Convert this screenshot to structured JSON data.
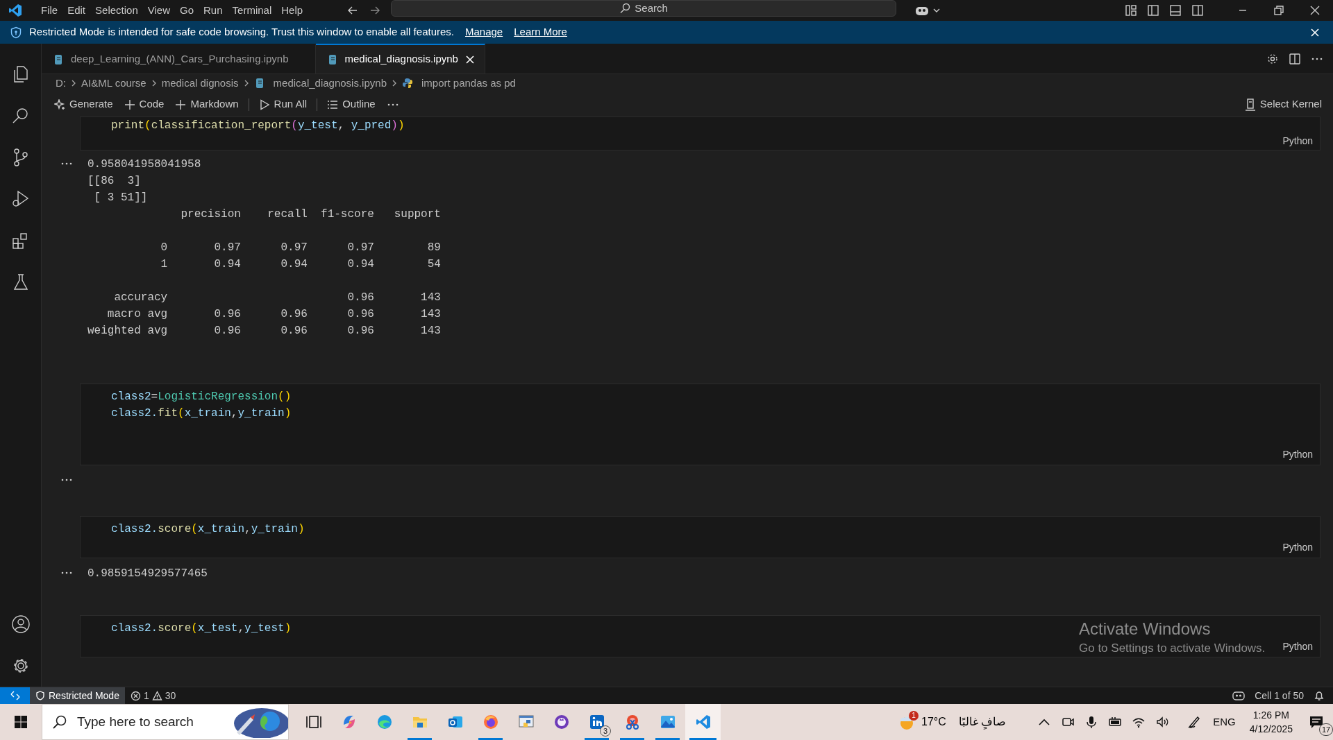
{
  "title_bar": {
    "menu": [
      "File",
      "Edit",
      "Selection",
      "View",
      "Go",
      "Run",
      "Terminal",
      "Help"
    ],
    "search": "Search"
  },
  "banner": {
    "message": "Restricted Mode is intended for safe code browsing. Trust this window to enable all features.",
    "links": [
      "Manage",
      "Learn More"
    ]
  },
  "tabs": [
    {
      "label": "deep_Learning_(ANN)_Cars_Purchasing.ipynb",
      "selected": false
    },
    {
      "label": "medical_diagnosis.ipynb",
      "selected": true
    }
  ],
  "breadcrumb": [
    {
      "label": "D:",
      "kind": "folder"
    },
    {
      "label": "AI&ML course",
      "kind": "folder"
    },
    {
      "label": "medical dignosis",
      "kind": "folder"
    },
    {
      "label": "medical_diagnosis.ipynb",
      "kind": "notebook"
    },
    {
      "label": "import pandas as pd",
      "kind": "python"
    }
  ],
  "toolbar": {
    "actions": [
      {
        "label": "Generate",
        "kind": "sparkle",
        "divider_before": false
      },
      {
        "label": "Code",
        "kind": "plus",
        "divider_before": false
      },
      {
        "label": "Markdown",
        "kind": "plus",
        "divider_before": false
      },
      {
        "label": "Run All",
        "kind": "run",
        "divider_before": true
      },
      {
        "label": "Outline",
        "kind": "list",
        "divider_before": true
      }
    ],
    "kernel": "Select Kernel"
  },
  "cells": [
    {
      "kind": "code",
      "language": "Python",
      "lines": [
        [
          {
            "t": "print",
            "color": "#dcdcaa"
          },
          {
            "t": "(",
            "color": "#ffd700"
          },
          {
            "t": "classification_report",
            "color": "#dcdcaa"
          },
          {
            "t": "(",
            "color": "#da70d6"
          },
          {
            "t": "y_test",
            "color": "#9cdcfe"
          },
          {
            "t": ", ",
            "color": "#d4d4d4"
          },
          {
            "t": "y_pred",
            "color": "#9cdcfe"
          },
          {
            "t": ")",
            "color": "#da70d6"
          },
          {
            "t": ")",
            "color": "#ffd700"
          }
        ]
      ]
    },
    {
      "kind": "output",
      "blocks": [
        [
          "0.958041958041958",
          "[[86  3]",
          " [ 3 51]]",
          "              precision    recall  f1-score   support"
        ],
        [
          "           0       0.97      0.97      0.97        89",
          "           1       0.94      0.94      0.94        54"
        ],
        [
          "    accuracy                           0.96       143",
          "   macro avg       0.96      0.96      0.96       143",
          "weighted avg       0.96      0.96      0.96       143"
        ]
      ]
    },
    {
      "kind": "code",
      "language": "Python",
      "lines": [
        [
          {
            "t": "class2",
            "color": "#9cdcfe"
          },
          {
            "t": "=",
            "color": "#d4d4d4"
          },
          {
            "t": "LogisticRegression",
            "color": "#4ec9b0"
          },
          {
            "t": "()",
            "color": "#ffd700"
          }
        ],
        [
          {
            "t": "class2.",
            "color": "#9cdcfe"
          },
          {
            "t": "fit",
            "color": "#dcdcaa"
          },
          {
            "t": "(",
            "color": "#ffd700"
          },
          {
            "t": "x_train",
            "color": "#9cdcfe"
          },
          {
            "t": ",",
            "color": "#d4d4d4"
          },
          {
            "t": "y_train",
            "color": "#9cdcfe"
          },
          {
            "t": ")",
            "color": "#ffd700"
          }
        ]
      ]
    },
    {
      "kind": "output"
    },
    {
      "kind": "code",
      "language": "Python",
      "lines": [
        [
          {
            "t": "class2.",
            "color": "#9cdcfe"
          },
          {
            "t": "score",
            "color": "#dcdcaa"
          },
          {
            "t": "(",
            "color": "#ffd700"
          },
          {
            "t": "x_train",
            "color": "#9cdcfe"
          },
          {
            "t": ",",
            "color": "#d4d4d4"
          },
          {
            "t": "y_train",
            "color": "#9cdcfe"
          },
          {
            "t": ")",
            "color": "#ffd700"
          }
        ]
      ]
    },
    {
      "kind": "output",
      "blocks": [
        [
          "0.9859154929577465"
        ]
      ]
    },
    {
      "kind": "code",
      "language": "Python",
      "lines": [
        [
          {
            "t": "class2.",
            "color": "#9cdcfe"
          },
          {
            "t": "score",
            "color": "#dcdcaa"
          },
          {
            "t": "(",
            "color": "#ffd700"
          },
          {
            "t": "x_test",
            "color": "#9cdcfe"
          },
          {
            "t": ",",
            "color": "#d4d4d4"
          },
          {
            "t": "y_test",
            "color": "#9cdcfe"
          },
          {
            "t": ")",
            "color": "#ffd700"
          }
        ]
      ]
    }
  ],
  "activation": {
    "title": "Activate Windows",
    "subtitle": "Go to Settings to activate Windows."
  },
  "status_bar": {
    "mode": "Restricted Mode",
    "errors": "1",
    "warnings": "30",
    "cell": "Cell 1 of 50"
  },
  "taskbar": {
    "search_placeholder": "Type here to search",
    "apps": [
      {
        "kind": "taskview",
        "running": false,
        "selected": false
      },
      {
        "kind": "copilot",
        "running": false,
        "selected": false
      },
      {
        "kind": "edge",
        "running": false,
        "selected": false
      },
      {
        "kind": "folder",
        "running": true,
        "selected": false
      },
      {
        "kind": "mail",
        "running": false,
        "selected": false
      },
      {
        "kind": "firefox",
        "running": true,
        "selected": false
      },
      {
        "kind": "python",
        "running": false,
        "selected": false
      },
      {
        "kind": "github",
        "running": false,
        "selected": false
      },
      {
        "kind": "linkedin",
        "running": true,
        "selected": false,
        "badge": "3"
      },
      {
        "kind": "snip",
        "running": true,
        "selected": false
      },
      {
        "kind": "photos",
        "running": true,
        "selected": false
      },
      {
        "kind": "vscode",
        "running": true,
        "selected": true
      }
    ],
    "weather": {
      "badge": "1",
      "temperature": "17°C",
      "condition": "صافٍ غالبًا"
    },
    "language": "ENG",
    "time": "1:26 PM",
    "date": "4/12/2025",
    "notifications": "17"
  }
}
